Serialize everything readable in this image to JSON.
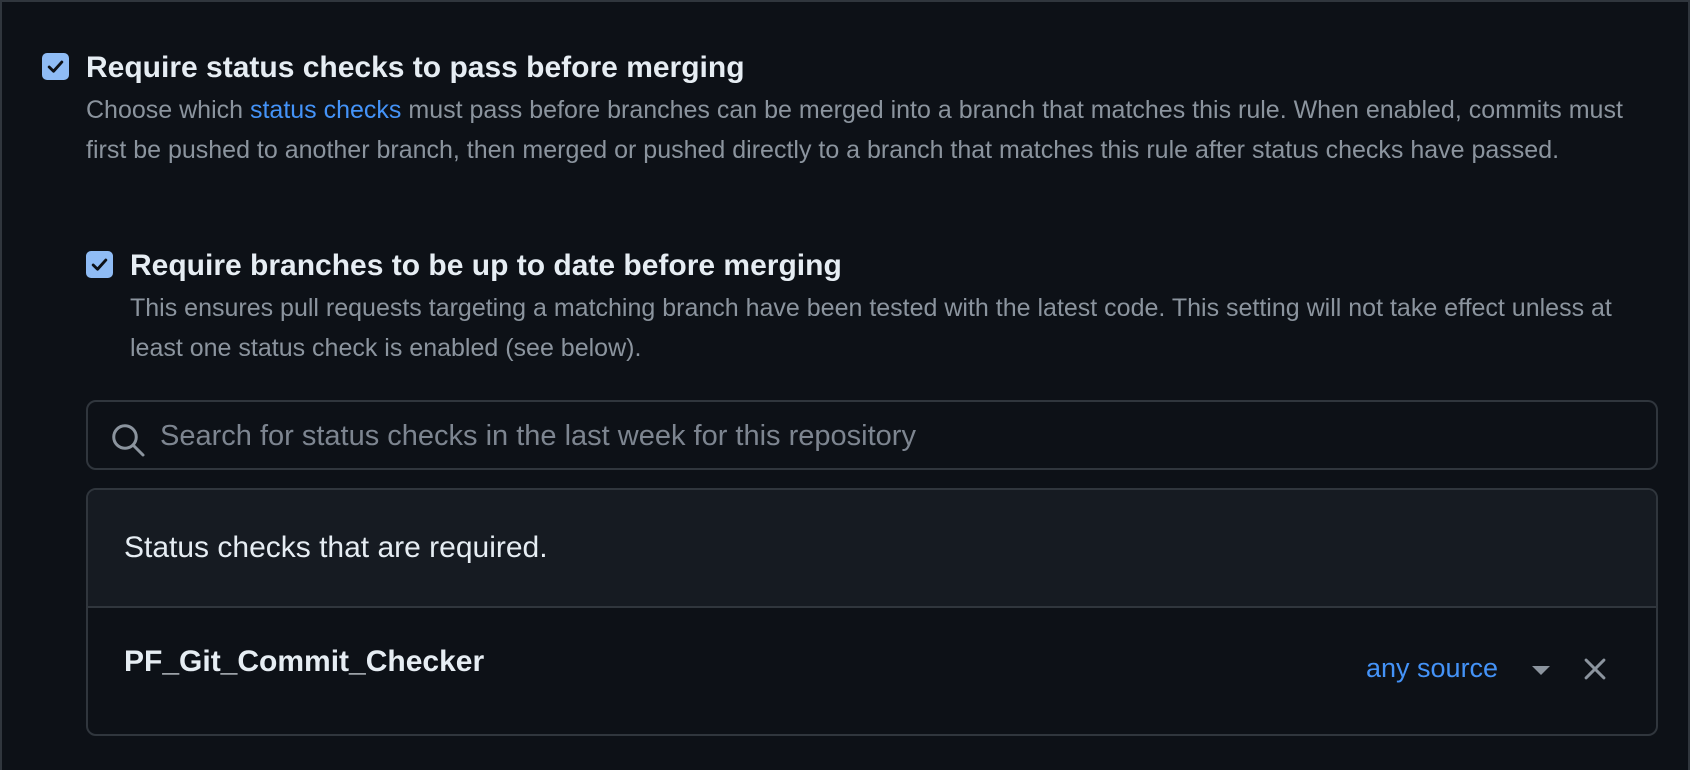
{
  "status_checks_rule": {
    "checked": true,
    "title": "Require status checks to pass before merging",
    "description_prefix": "Choose which ",
    "description_link": "status checks",
    "description_suffix": " must pass before branches can be merged into a branch that matches this rule. When enabled, commits must first be pushed to another branch, then merged or pushed directly to a branch that matches this rule after status checks have passed."
  },
  "up_to_date_rule": {
    "checked": true,
    "title": "Require branches to be up to date before merging",
    "description": "This ensures pull requests targeting a matching branch have been tested with the latest code. This setting will not take effect unless at least one status check is enabled (see below)."
  },
  "search": {
    "placeholder": "Search for status checks in the last week for this repository",
    "value": ""
  },
  "required_checks": {
    "header": "Status checks that are required.",
    "items": [
      {
        "name": "PF_Git_Commit_Checker",
        "source": "any source"
      }
    ]
  },
  "colors": {
    "background": "#0d1117",
    "panel_header": "#161b22",
    "border": "#30363d",
    "text_primary": "#e6edf3",
    "text_muted": "#8b949e",
    "accent_link": "#4493f8",
    "checkbox_fill": "#8fbcf5"
  },
  "icons": {
    "checkbox": "checkmark-icon",
    "search": "search-icon",
    "dropdown": "triangle-down-icon",
    "remove": "close-icon"
  }
}
